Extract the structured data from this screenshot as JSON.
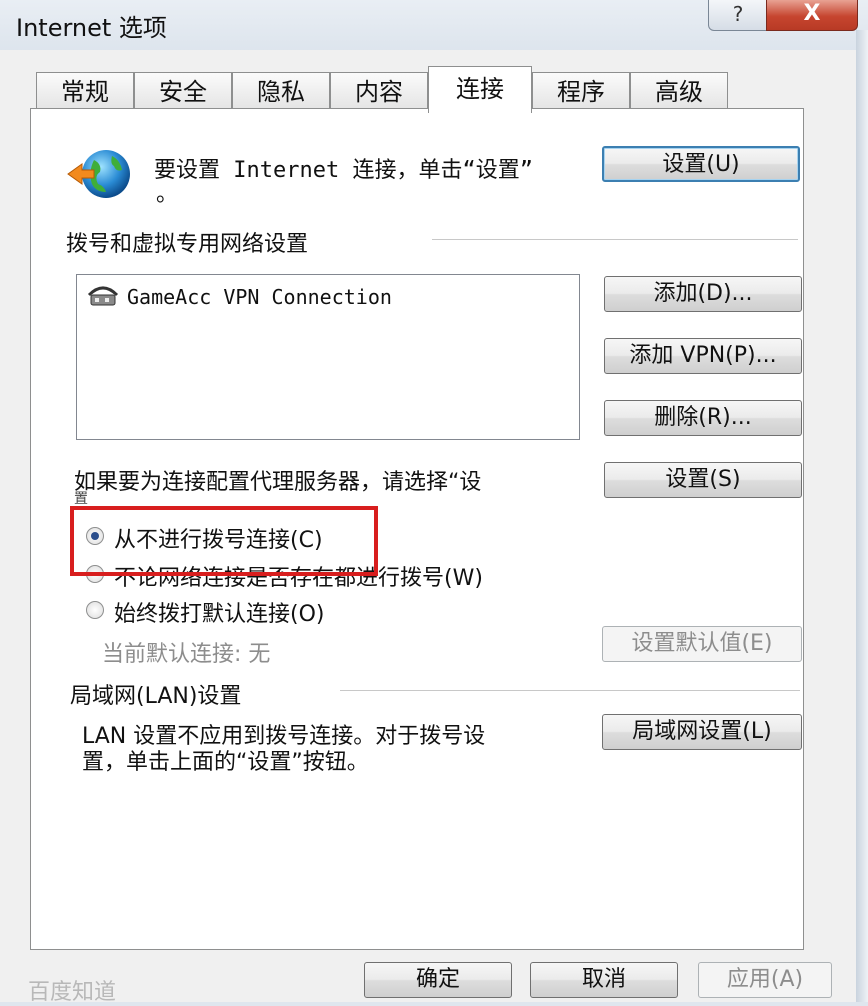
{
  "window": {
    "title": "Internet 选项",
    "help_label": "?",
    "close_label": "X"
  },
  "tabs": [
    {
      "label": "常规",
      "active": false
    },
    {
      "label": "安全",
      "active": false
    },
    {
      "label": "隐私",
      "active": false
    },
    {
      "label": "内容",
      "active": false
    },
    {
      "label": "连接",
      "active": true
    },
    {
      "label": "程序",
      "active": false
    },
    {
      "label": "高级",
      "active": false
    }
  ],
  "setup": {
    "line1": "要设置 Internet 连接，单击“设置”",
    "line2": "。",
    "button": "设置(U)",
    "icon": "globe-connect-icon"
  },
  "dialup": {
    "section_label": "拨号和虚拟专用网络设置",
    "connections": [
      {
        "name": "GameAcc VPN Connection",
        "icon": "vpn-connection-icon"
      }
    ],
    "add_button": "添加(D)...",
    "add_vpn_button": "添加 VPN(P)...",
    "remove_button": "删除(R)...",
    "proxy_text": "如果要为连接配置代理服务器，请选择“设",
    "proxy_text_overflow": "置",
    "settings_button": "设置(S)"
  },
  "dial_options": [
    {
      "label": "从不进行拨号连接(C)",
      "checked": true
    },
    {
      "label": "不论网络连接是否存在都进行拨号(W)",
      "checked": false
    },
    {
      "label": "始终拨打默认连接(O)",
      "checked": false
    }
  ],
  "default_connection": {
    "label": "当前默认连接: 无",
    "button": "设置默认值(E)"
  },
  "lan": {
    "section_label": "局域网(LAN)设置",
    "line1": "LAN 设置不应用到拨号连接。对于拨号设",
    "line2": "置，单击上面的“设置”按钮。",
    "button": "局域网设置(L)"
  },
  "footer": {
    "ok": "确定",
    "cancel": "取消",
    "apply": "应用(A)",
    "watermark": "百度知道"
  },
  "colors": {
    "highlight": "#d81e1e",
    "accent": "#3c7fb1"
  }
}
